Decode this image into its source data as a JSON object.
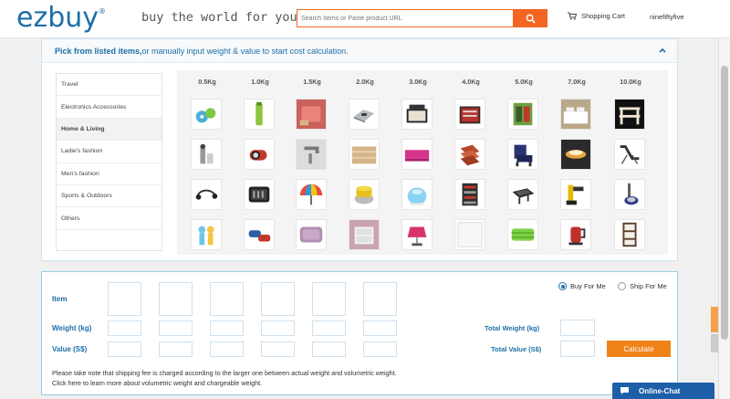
{
  "header": {
    "logo": "ezbuy",
    "logo_mark": "®",
    "slogan": "buy the world for you",
    "search_placeholder": "Search Items or Paste product URL",
    "cart_label": "Shopping Cart",
    "username": "ninefiftyfive"
  },
  "picker": {
    "title_bold": "Pick from listed items,",
    "title_rest": "or manually input weight & value to start cost calculation.",
    "categories": [
      "Travel",
      "Electronics Accessories",
      "Home & Living",
      "Ladie's fashion",
      "Men's fashion",
      "Sports & Outdoors",
      "Others"
    ],
    "active_category": "Home & Living",
    "weights": [
      "0.5Kg",
      "1.0Kg",
      "1.5Kg",
      "2.0Kg",
      "3.0Kg",
      "4.0Kg",
      "5.0Kg",
      "7.0Kg",
      "10.0Kg"
    ]
  },
  "calculator": {
    "item_label": "Item",
    "weight_label": "Weight (kg)",
    "value_label": "Value (S$)",
    "buy_for_me": "Buy For Me",
    "ship_for_me": "Ship For Me",
    "selected_mode": "Buy For Me",
    "total_weight_label": "Total Weight (kg)",
    "total_value_label": "Total Value (S$)",
    "calculate_label": "Calculate",
    "note_line1": "Please take note that shipping fee is charged according to the larger one between actual weight and volumetric weight.",
    "note_line2": "Click here to learn more about volumetric weight and chargeable weight."
  },
  "chat": {
    "label": "Online-Chat"
  },
  "colors": {
    "brand_blue": "#1d6fa8",
    "accent_orange": "#f26522",
    "button_orange": "#f08218"
  }
}
